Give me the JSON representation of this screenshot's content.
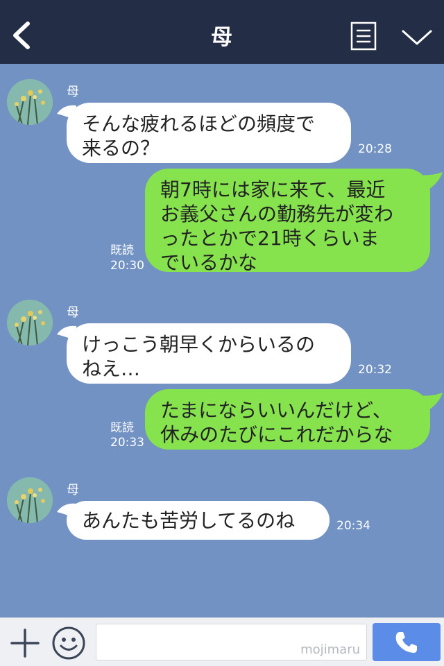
{
  "header": {
    "title": "母",
    "icons": [
      "back-icon",
      "note-icon",
      "chevron-down-icon"
    ]
  },
  "colors": {
    "header_bg": "#232d45",
    "chat_bg": "#7192c2",
    "incoming_bubble": "#ffffff",
    "outgoing_bubble": "#86e34e",
    "call_button": "#5a8ce8"
  },
  "messages": [
    {
      "direction": "in",
      "sender": "母",
      "lines": [
        "そんな疲れるほどの頻度で",
        "来るの？"
      ],
      "time": "20:28"
    },
    {
      "direction": "out",
      "read": "既読",
      "lines": [
        "朝7時には家に来て、最近",
        "お義父さんの勤務先が変わ",
        "ったとかで21時くらいま",
        "でいるかな"
      ],
      "time": "20:30"
    },
    {
      "direction": "in",
      "sender": "母",
      "lines": [
        "けっこう朝早くからいるの",
        "ねえ…"
      ],
      "time": "20:32"
    },
    {
      "direction": "out",
      "read": "既読",
      "lines": [
        "たまにならいいんだけど、",
        "休みのたびにこれだからな"
      ],
      "time": "20:33"
    },
    {
      "direction": "in",
      "sender": "母",
      "lines": [
        "あんたも苦労してるのね"
      ],
      "time": "20:34"
    }
  ],
  "footer": {
    "input_value": "",
    "watermark": "mojimaru",
    "icons": [
      "plus-icon",
      "smile-icon",
      "phone-icon"
    ]
  }
}
